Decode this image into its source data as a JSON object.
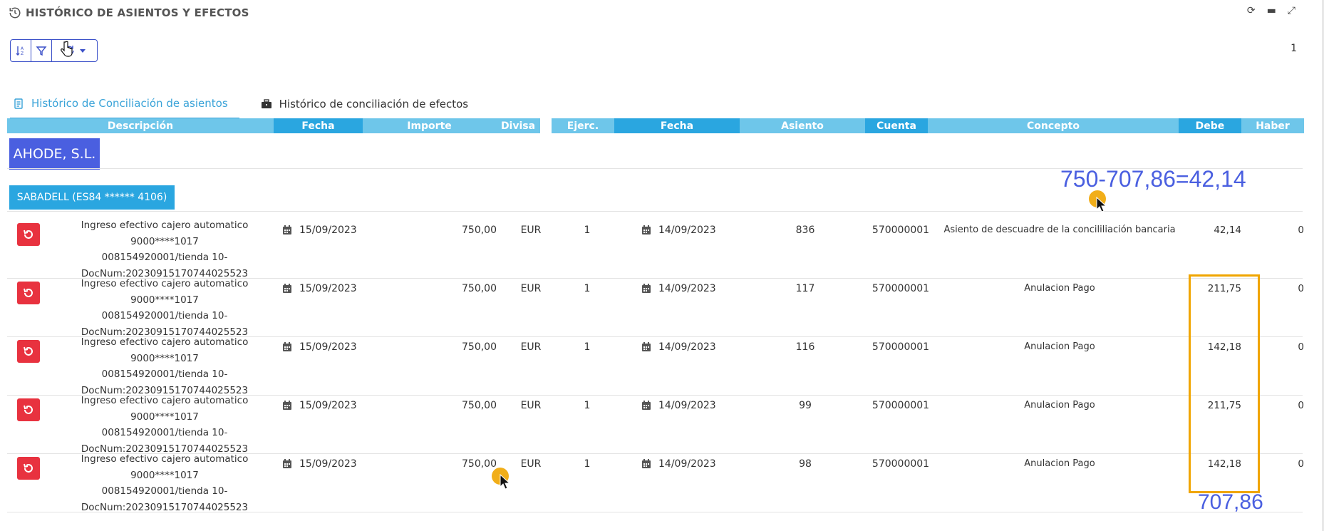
{
  "panel": {
    "title": "HISTÓRICO DE ASIENTOS Y EFECTOS",
    "page_number": "1"
  },
  "window_controls": [
    "refresh-icon",
    "minimize-icon",
    "expand-icon"
  ],
  "toolbar": {
    "icons": [
      "sort-icon",
      "filter-icon",
      "refresh-dropdown-icon"
    ]
  },
  "tabs": [
    {
      "label": "Histórico de Conciliación de asientos",
      "icon": "clipboard-icon",
      "active": true
    },
    {
      "label": "Histórico de conciliación de efectos",
      "icon": "briefcase-icon",
      "active": false
    }
  ],
  "columns": {
    "descripcion": "Descripción",
    "fecha": "Fecha",
    "importe": "Importe",
    "divisa": "Divisa",
    "ejerc": "Ejerc.",
    "fecha2": "Fecha",
    "asiento": "Asiento",
    "cuenta": "Cuenta",
    "concepto": "Concepto",
    "debe": "Debe",
    "haber": "Haber"
  },
  "company": "AHODE, S.L.",
  "bank": "SABADELL (ES84 ****** 4106)",
  "rows": [
    {
      "desc1": "Ingreso efectivo cajero automatico 9000****1017",
      "desc2": "008154920001/tienda 10-",
      "desc3": "DocNum:20230915170744025523",
      "fecha": "15/09/2023",
      "importe": "750,00",
      "divisa": "EUR",
      "ejerc": "1",
      "fecha2": "14/09/2023",
      "asiento": "836",
      "cuenta": "570000001",
      "concepto": "Asiento de descuadre de la concililiación bancaria",
      "debe": "42,14",
      "haber": "0"
    },
    {
      "desc1": "Ingreso efectivo cajero automatico 9000****1017",
      "desc2": "008154920001/tienda 10-",
      "desc3": "DocNum:20230915170744025523",
      "fecha": "15/09/2023",
      "importe": "750,00",
      "divisa": "EUR",
      "ejerc": "1",
      "fecha2": "14/09/2023",
      "asiento": "117",
      "cuenta": "570000001",
      "concepto": "Anulacion Pago",
      "debe": "211,75",
      "haber": "0"
    },
    {
      "desc1": "Ingreso efectivo cajero automatico 9000****1017",
      "desc2": "008154920001/tienda 10-",
      "desc3": "DocNum:20230915170744025523",
      "fecha": "15/09/2023",
      "importe": "750,00",
      "divisa": "EUR",
      "ejerc": "1",
      "fecha2": "14/09/2023",
      "asiento": "116",
      "cuenta": "570000001",
      "concepto": "Anulacion Pago",
      "debe": "142,18",
      "haber": "0"
    },
    {
      "desc1": "Ingreso efectivo cajero automatico 9000****1017",
      "desc2": "008154920001/tienda 10-",
      "desc3": "DocNum:20230915170744025523",
      "fecha": "15/09/2023",
      "importe": "750,00",
      "divisa": "EUR",
      "ejerc": "1",
      "fecha2": "14/09/2023",
      "asiento": "99",
      "cuenta": "570000001",
      "concepto": "Anulacion Pago",
      "debe": "211,75",
      "haber": "0"
    },
    {
      "desc1": "Ingreso efectivo cajero automatico 9000****1017",
      "desc2": "008154920001/tienda 10-",
      "desc3": "DocNum:20230915170744025523",
      "fecha": "15/09/2023",
      "importe": "750,00",
      "divisa": "EUR",
      "ejerc": "1",
      "fecha2": "14/09/2023",
      "asiento": "98",
      "cuenta": "570000001",
      "concepto": "Anulacion Pago",
      "debe": "142,18",
      "haber": "0"
    }
  ],
  "annotations": {
    "formula": "750-707,86=42,14",
    "total": "707,86"
  },
  "colors": {
    "header": "#6ec6ea",
    "header_dark": "#2aa6e0",
    "company": "#4a5fe0",
    "undo": "#e8323f",
    "highlight": "#f0a500",
    "annotation": "#4a5fe0"
  }
}
